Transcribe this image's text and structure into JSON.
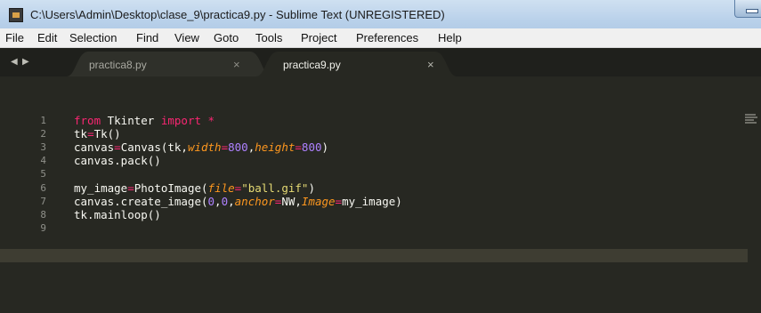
{
  "window": {
    "title": "C:\\Users\\Admin\\Desktop\\clase_9\\practica9.py - Sublime Text (UNREGISTERED)"
  },
  "menu": [
    "File",
    "Edit",
    "Selection",
    "Find",
    "View",
    "Goto",
    "Tools",
    "Project",
    "Preferences",
    "Help"
  ],
  "tabs": [
    {
      "label": "practica8.py",
      "close": "×"
    },
    {
      "label": "practica9.py",
      "close": "×"
    }
  ],
  "nav": {
    "left": "◀",
    "right": "▶"
  },
  "editor": {
    "line_numbers": [
      "1",
      "2",
      "3",
      "4",
      "5",
      "6",
      "7",
      "8",
      "9"
    ],
    "code": [
      [
        {
          "t": "from",
          "c": "kw"
        },
        {
          "t": " Tkinter ",
          "c": ""
        },
        {
          "t": "import",
          "c": "kw"
        },
        {
          "t": " *",
          "c": "op"
        }
      ],
      [
        {
          "t": "tk",
          "c": ""
        },
        {
          "t": "=",
          "c": "op"
        },
        {
          "t": "Tk()",
          "c": ""
        }
      ],
      [
        {
          "t": "canvas",
          "c": ""
        },
        {
          "t": "=",
          "c": "op"
        },
        {
          "t": "Canvas(tk,",
          "c": ""
        },
        {
          "t": "width",
          "c": "arg"
        },
        {
          "t": "=",
          "c": "op"
        },
        {
          "t": "800",
          "c": "num"
        },
        {
          "t": ",",
          "c": ""
        },
        {
          "t": "height",
          "c": "arg"
        },
        {
          "t": "=",
          "c": "op"
        },
        {
          "t": "800",
          "c": "num"
        },
        {
          "t": ")",
          "c": ""
        }
      ],
      [
        {
          "t": "canvas.pack()",
          "c": ""
        }
      ],
      [],
      [
        {
          "t": "my_image",
          "c": ""
        },
        {
          "t": "=",
          "c": "op"
        },
        {
          "t": "PhotoImage(",
          "c": ""
        },
        {
          "t": "file",
          "c": "arg"
        },
        {
          "t": "=",
          "c": "op"
        },
        {
          "t": "\"ball.gif\"",
          "c": "str"
        },
        {
          "t": ")",
          "c": ""
        }
      ],
      [
        {
          "t": "canvas.create_image(",
          "c": ""
        },
        {
          "t": "0",
          "c": "num"
        },
        {
          "t": ",",
          "c": ""
        },
        {
          "t": "0",
          "c": "num"
        },
        {
          "t": ",",
          "c": ""
        },
        {
          "t": "anchor",
          "c": "arg"
        },
        {
          "t": "=",
          "c": "op"
        },
        {
          "t": "NW,",
          "c": ""
        },
        {
          "t": "Image",
          "c": "arg"
        },
        {
          "t": "=",
          "c": "op"
        },
        {
          "t": "my_image)",
          "c": ""
        }
      ],
      [
        {
          "t": "tk.mainloop()",
          "c": ""
        }
      ],
      []
    ]
  },
  "colors": {
    "background": "#272822",
    "keyword": "#f92672",
    "number": "#ae81ff",
    "string": "#e6db74",
    "argument": "#fd971f"
  }
}
